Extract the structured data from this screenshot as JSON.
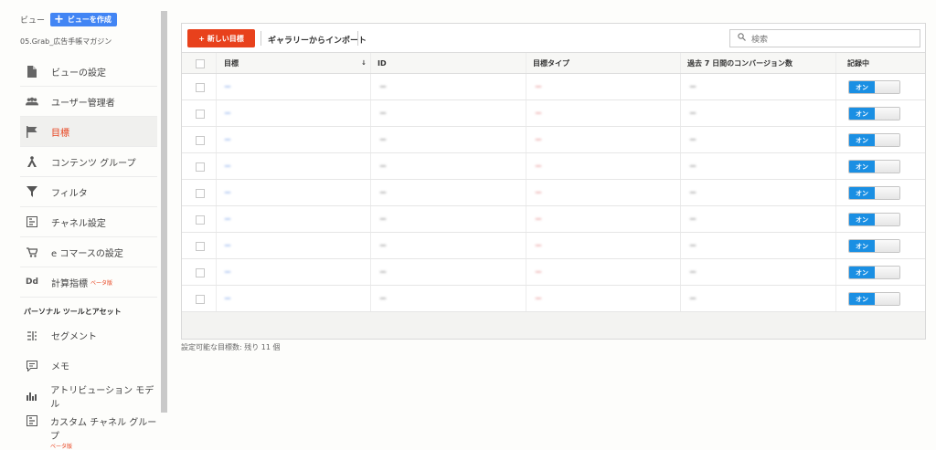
{
  "sidebar": {
    "view_label": "ビュー",
    "create_view_button": "ビューを作成",
    "view_name": "05.Grab_広告手帳マガジン",
    "items": [
      {
        "label": "ビューの設定",
        "icon": "document-icon"
      },
      {
        "label": "ユーザー管理者",
        "icon": "users-icon"
      },
      {
        "label": "目標",
        "icon": "flag-icon",
        "active": true
      },
      {
        "label": "コンテンツ グループ",
        "icon": "content-group-icon"
      },
      {
        "label": "フィルタ",
        "icon": "filter-icon"
      },
      {
        "label": "チャネル設定",
        "icon": "channel-icon"
      },
      {
        "label": "e コマースの設定",
        "icon": "cart-icon"
      },
      {
        "label": "計算指標",
        "icon": "dd-icon",
        "badge": "ベータ版"
      }
    ],
    "section_title": "パーソナル ツールとアセット",
    "tools": [
      {
        "label": "セグメント",
        "icon": "segment-icon"
      },
      {
        "label": "メモ",
        "icon": "memo-icon"
      },
      {
        "label": "アトリビューション モデル",
        "icon": "bar-chart-icon"
      },
      {
        "label": "カスタム チャネル グループ",
        "icon": "custom-channel-icon",
        "badge": "ベータ版"
      }
    ]
  },
  "toolbar": {
    "new_goal_button": "+ 新しい目標",
    "import_gallery": "ギャラリーからインポート",
    "search_placeholder": "検索"
  },
  "table": {
    "headers": {
      "goal": "目標",
      "id": "ID",
      "goal_type": "目標タイプ",
      "conversions": "過去 7 日間のコンバージョン数",
      "recording": "記録中"
    },
    "rows": [
      {
        "goal": "ー",
        "id": "ー",
        "type": "ー",
        "conversions": "ー",
        "toggle": "オン"
      },
      {
        "goal": "ー",
        "id": "ー",
        "type": "ー",
        "conversions": "ー",
        "toggle": "オン"
      },
      {
        "goal": "ー",
        "id": "ー",
        "type": "ー",
        "conversions": "ー",
        "toggle": "オン"
      },
      {
        "goal": "ー",
        "id": "ー",
        "type": "ー",
        "conversions": "ー",
        "toggle": "オン"
      },
      {
        "goal": "ー",
        "id": "ー",
        "type": "ー",
        "conversions": "ー",
        "toggle": "オン"
      },
      {
        "goal": "ー",
        "id": "ー",
        "type": "ー",
        "conversions": "ー",
        "toggle": "オン"
      },
      {
        "goal": "ー",
        "id": "ー",
        "type": "ー",
        "conversions": "ー",
        "toggle": "オン"
      },
      {
        "goal": "ー",
        "id": "ー",
        "type": "ー",
        "conversions": "ー",
        "toggle": "オン"
      },
      {
        "goal": "ー",
        "id": "ー",
        "type": "ー",
        "conversions": "ー",
        "toggle": "オン"
      }
    ]
  },
  "footer": {
    "remaining_goals": "設定可能な目標数: 残り 11 個"
  },
  "colors": {
    "accent_red": "#e8411c",
    "toggle_blue": "#1a8fe3",
    "view_button_blue": "#4285f4"
  }
}
